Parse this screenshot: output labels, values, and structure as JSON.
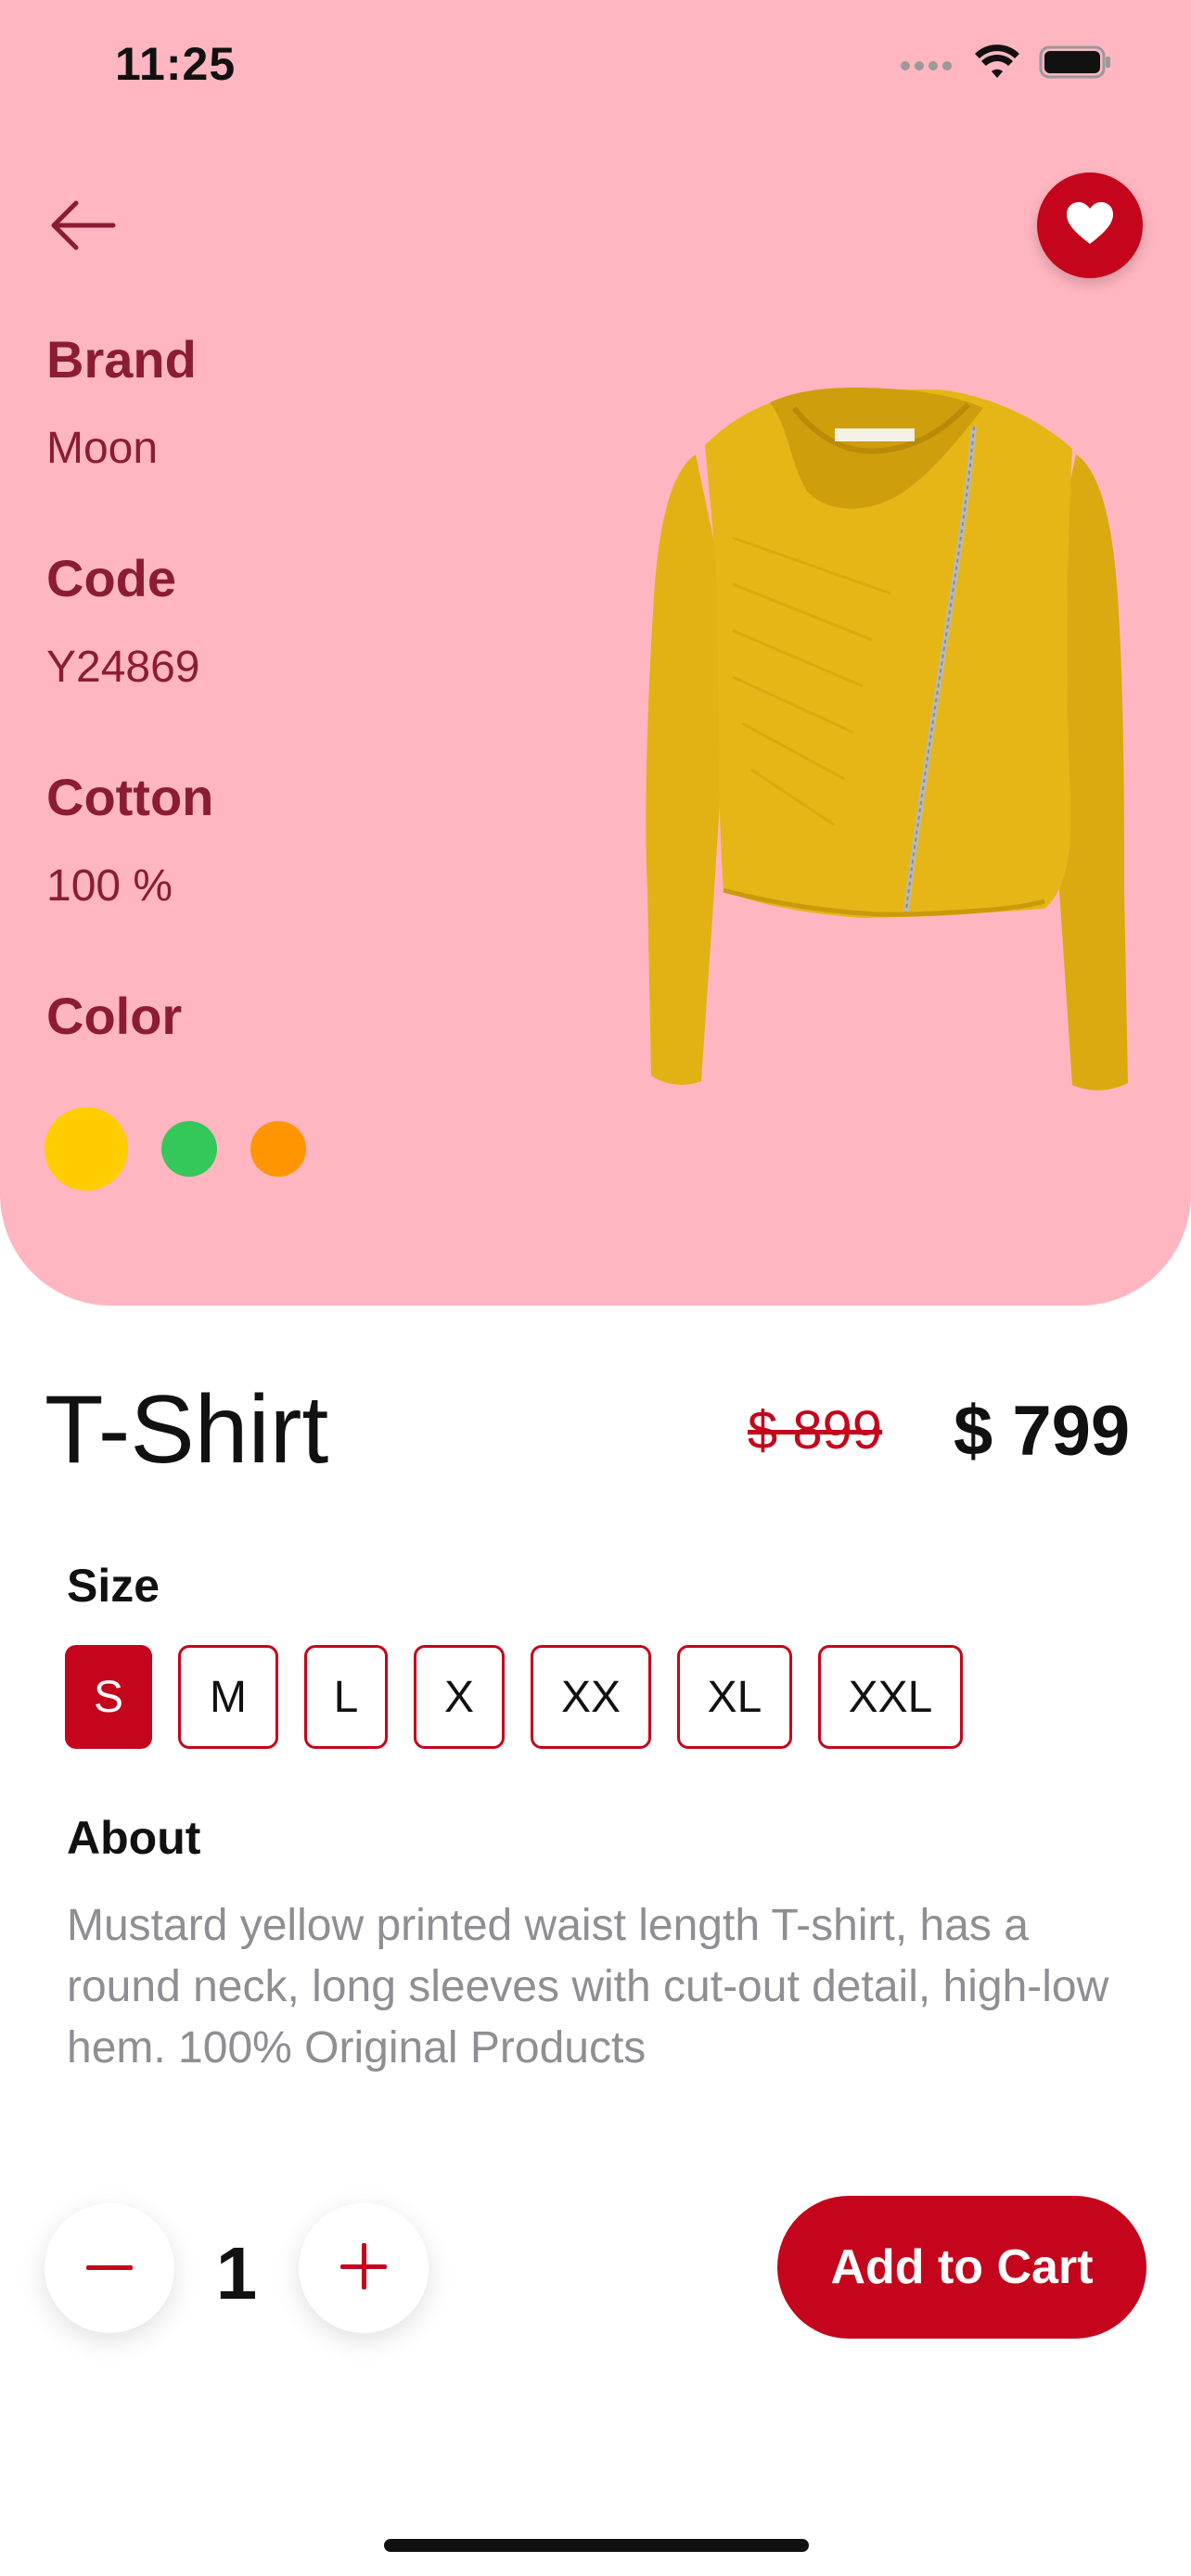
{
  "status_bar": {
    "time": "11:25"
  },
  "icons": {
    "back": "arrow-left-icon",
    "favorite": "heart-icon",
    "minus": "minus-icon",
    "plus": "plus-icon"
  },
  "specs": [
    {
      "label": "Brand",
      "value": "Moon"
    },
    {
      "label": "Code",
      "value": "Y24869"
    },
    {
      "label": "Cotton",
      "value": "100 %"
    },
    {
      "label": "Color",
      "value": ""
    }
  ],
  "colors": {
    "swatches": [
      "#FFCC00",
      "#34C759",
      "#FF9500"
    ],
    "selected": 0,
    "accent": "#C4051C",
    "hero_bg": "#FFB6C1"
  },
  "product": {
    "title": "T-Shirt",
    "old_price": "$ 899",
    "price": "$ 799"
  },
  "size": {
    "heading": "Size",
    "options": [
      "S",
      "M",
      "L",
      "X",
      "XX",
      "XL",
      "XXL"
    ],
    "selected": "S"
  },
  "about": {
    "heading": "About",
    "text": "Mustard yellow printed waist length T-shirt, has a round neck, long sleeves with cut-out detail, high-low hem. 100% Original Products"
  },
  "cart": {
    "quantity": "1",
    "button_label": "Add to Cart"
  }
}
